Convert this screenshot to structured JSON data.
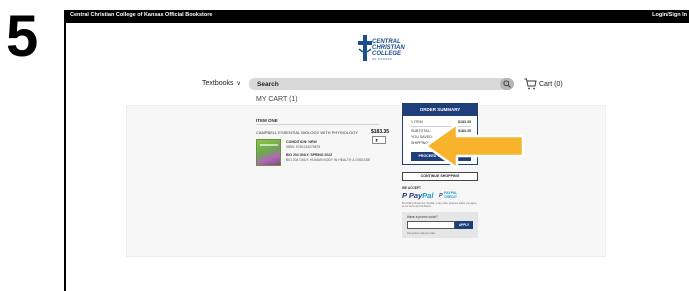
{
  "step_number": "5",
  "topbar": {
    "store_name": "Central Christian College of Kansas Official Bookstore",
    "login_label": "Login/Sign In"
  },
  "logo": {
    "line1": "CENTRAL",
    "line2": "CHRISTIAN",
    "line3": "COLLEGE",
    "line4": "OF KANSAS"
  },
  "nav": {
    "textbooks_label": "Textbooks",
    "search_placeholder": "Search",
    "cart_label": "Cart (0)"
  },
  "cart": {
    "title": "MY CART (1)",
    "section_label": "ITEM ONE",
    "item": {
      "title": "CAMPBELL ESSENTIAL BIOLOGY WITH PHYSIOLOGY",
      "price": "$183.35",
      "quantity": "1",
      "condition": "CONDITION: NEW",
      "isbn": "ISBN: 9780134075875",
      "course_term": "BIO 204 ONLY: SPRING 2022",
      "course_name": "BIO 204 ONLY: HUMAN BODY IN HEALTH & DISEASE"
    }
  },
  "order_summary": {
    "header": "ORDER SUMMARY",
    "rows": [
      {
        "label": "1 ITEM",
        "value": "$183.35"
      },
      {
        "label": "SUBTOTAL:",
        "value": "$183.35"
      },
      {
        "label": "YOU SAVED:",
        "value": ""
      },
      {
        "label": "SHIPPING:",
        "value": "FREE"
      }
    ],
    "checkout_label": "PROCEED TO CHECKOUT"
  },
  "continue_label": "CONTINUE SHOPPING",
  "payments": {
    "we_accept": "WE ACCEPT",
    "paypal_pay": "Pay",
    "paypal_pal": "Pal",
    "paypal_credit_p": "P",
    "paypal_credit_pay": "PAYPAL",
    "paypal_credit_word": "CREDIT",
    "note": "By clicking Check Out, PayPal, or any other payment option you agree to our terms and conditions."
  },
  "promo": {
    "question": "Have a promo code?",
    "apply_label": "APPLY",
    "note": "One promo code per order."
  },
  "colors": {
    "brand_navy": "#1f3f7a",
    "callout_arrow": "#f7b32b"
  }
}
